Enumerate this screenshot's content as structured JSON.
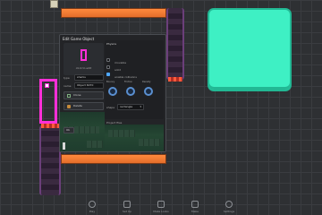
{
  "dialog": {
    "title": "Edit Game Object",
    "sprite_hint": "click to edit",
    "type_label": "type",
    "type_value": "sharks",
    "name_label": "name",
    "name_value": "Object 6070",
    "clone_label": "Clone",
    "delete_label": "Delete",
    "ok_label": "Ok",
    "physics": {
      "heading": "Physics",
      "options": [
        {
          "label": "movable",
          "checked": false
        },
        {
          "label": "solid",
          "checked": false
        },
        {
          "label": "enable collisions",
          "checked": true
        }
      ],
      "dials": [
        "Bouncy",
        "Friction",
        "Density"
      ],
      "shape_label": "shape",
      "shape_value": "rectangle",
      "project_files_label": "Project files"
    }
  },
  "toolbar": {
    "items": [
      {
        "label": "Play",
        "icon": "play-icon"
      },
      {
        "label": "Set Up",
        "icon": "cube-icon"
      },
      {
        "label": "Make Looks",
        "icon": "image-icon"
      },
      {
        "label": "Make",
        "icon": "frame-icon"
      },
      {
        "label": "Settings",
        "icon": "gear-icon"
      }
    ]
  },
  "colors": {
    "accent": "#4fa8ff",
    "teal": "#3ef0c4",
    "orange": "#ff8a3d",
    "magenta": "#ff2fd8"
  }
}
